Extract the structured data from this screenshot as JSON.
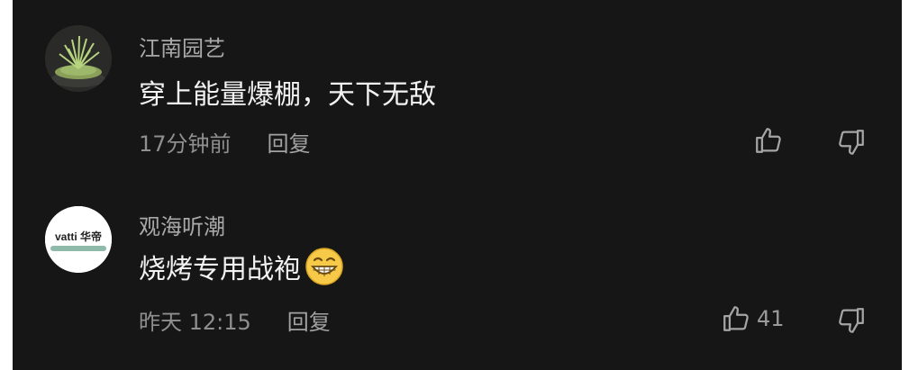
{
  "comments": [
    {
      "username": "江南园艺",
      "text": "穿上能量爆棚，天下无敌",
      "time": "17分钟前",
      "reply_label": "回复",
      "like_count": "",
      "avatar_icon": "bonsai-plant-avatar"
    },
    {
      "username": "观海听潮",
      "text": "烧烤专用战袍",
      "emoji": "grinning-face-emoji",
      "time": "昨天 12:15",
      "reply_label": "回复",
      "like_count": "41",
      "avatar_icon": "vatti-logo-avatar",
      "avatar_logo_text": "vatti 华帝"
    }
  ],
  "colors": {
    "background": "#161616",
    "username": "#a9a9a9",
    "text": "#f2f2f2",
    "meta": "#8f8f8f"
  }
}
